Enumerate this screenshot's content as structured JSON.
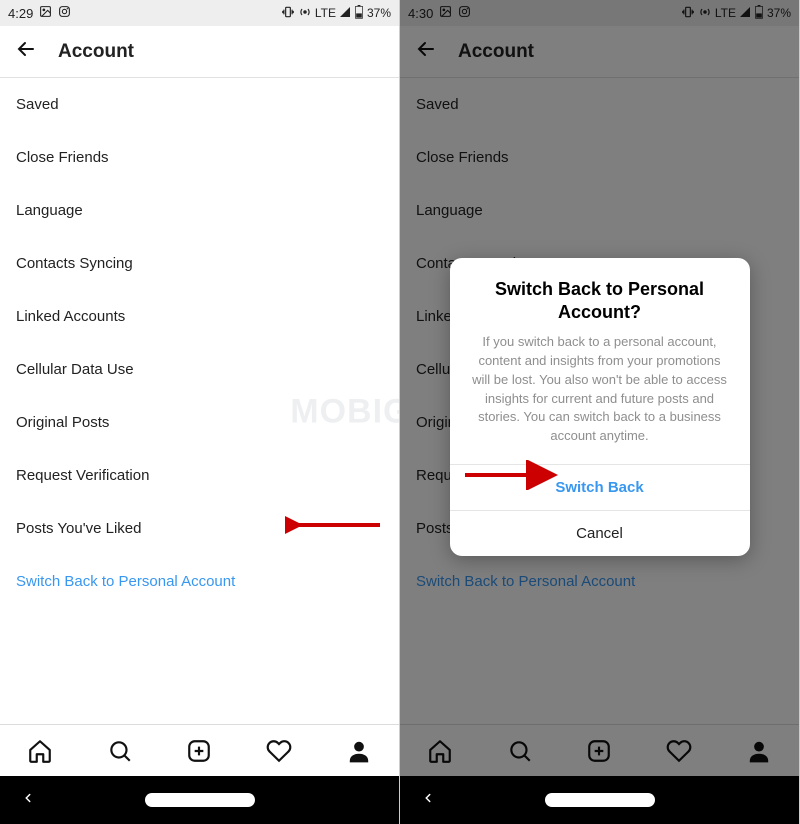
{
  "left": {
    "status": {
      "time": "4:29",
      "network": "LTE",
      "battery": "37%"
    },
    "header": {
      "title": "Account"
    },
    "items": [
      {
        "label": "Saved"
      },
      {
        "label": "Close Friends"
      },
      {
        "label": "Language"
      },
      {
        "label": "Contacts Syncing"
      },
      {
        "label": "Linked Accounts"
      },
      {
        "label": "Cellular Data Use"
      },
      {
        "label": "Original Posts"
      },
      {
        "label": "Request Verification"
      },
      {
        "label": "Posts You've Liked"
      },
      {
        "label": "Switch Back to Personal Account",
        "link": true
      }
    ]
  },
  "right": {
    "status": {
      "time": "4:30",
      "network": "LTE",
      "battery": "37%"
    },
    "header": {
      "title": "Account"
    },
    "items": [
      {
        "label": "Saved"
      },
      {
        "label": "Close Friends"
      },
      {
        "label": "Language"
      },
      {
        "label": "Contacts Syncing"
      },
      {
        "label": "Linked Accounts"
      },
      {
        "label": "Cellular Data Use"
      },
      {
        "label": "Original Posts"
      },
      {
        "label": "Request Verification"
      },
      {
        "label": "Posts You've Liked"
      },
      {
        "label": "Switch Back to Personal Account",
        "link": true
      }
    ],
    "modal": {
      "title": "Switch Back to Personal Account?",
      "body": "If you switch back to a personal account, content and insights from your promotions will be lost. You also won't be able to access insights for current and future posts and stories. You can switch back to a business account anytime.",
      "primary": "Switch Back",
      "secondary": "Cancel"
    }
  },
  "watermark": "MOBIGYAAN"
}
